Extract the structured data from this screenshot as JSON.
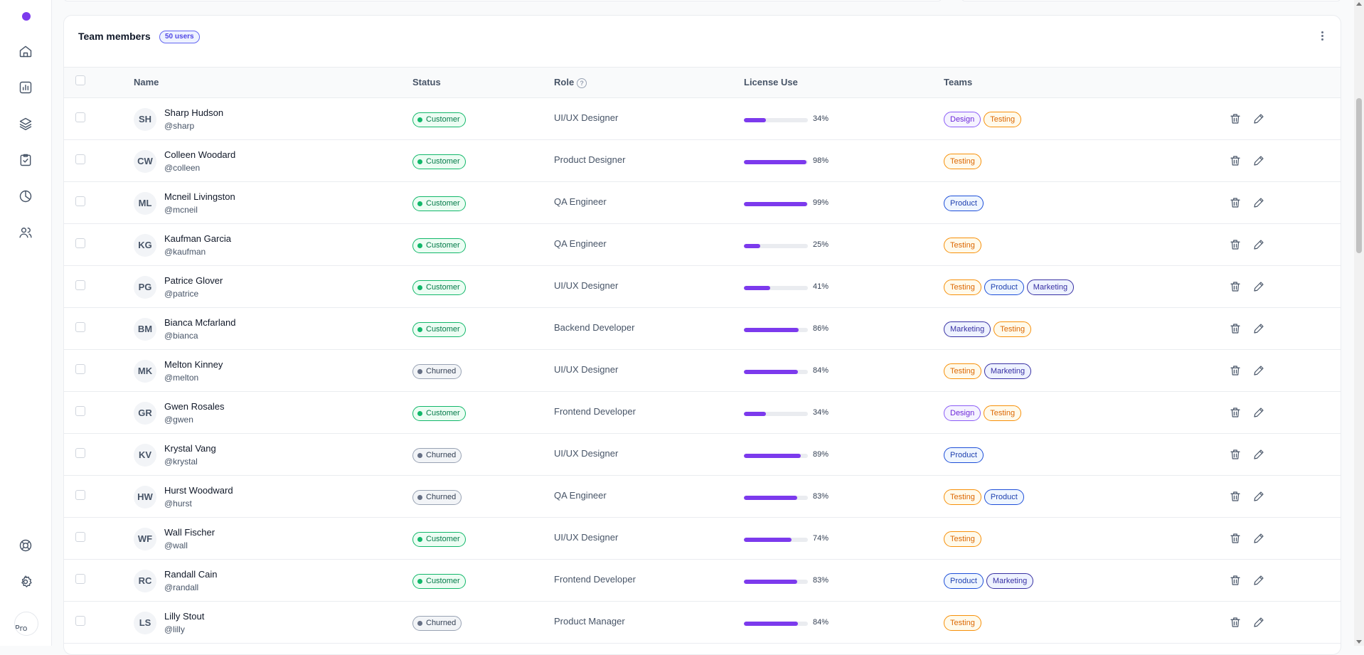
{
  "card": {
    "title": "Team members",
    "badge": "50 users"
  },
  "columns": {
    "name": "Name",
    "status": "Status",
    "role": "Role",
    "license": "License Use",
    "teams": "Teams"
  },
  "help_glyph": "?",
  "sidebar": {
    "avatar_alt": "Pro"
  },
  "rows": [
    {
      "initials": "SH",
      "name": "Sharp Hudson",
      "handle": "@sharp",
      "status": "Customer",
      "role": "UI/UX Designer",
      "license": 34,
      "license_text": "34%",
      "teams": [
        "Design",
        "Testing"
      ]
    },
    {
      "initials": "CW",
      "name": "Colleen Woodard",
      "handle": "@colleen",
      "status": "Customer",
      "role": "Product Designer",
      "license": 98,
      "license_text": "98%",
      "teams": [
        "Testing"
      ]
    },
    {
      "initials": "ML",
      "name": "Mcneil Livingston",
      "handle": "@mcneil",
      "status": "Customer",
      "role": "QA Engineer",
      "license": 99,
      "license_text": "99%",
      "teams": [
        "Product"
      ]
    },
    {
      "initials": "KG",
      "name": "Kaufman Garcia",
      "handle": "@kaufman",
      "status": "Customer",
      "role": "QA Engineer",
      "license": 25,
      "license_text": "25%",
      "teams": [
        "Testing"
      ]
    },
    {
      "initials": "PG",
      "name": "Patrice Glover",
      "handle": "@patrice",
      "status": "Customer",
      "role": "UI/UX Designer",
      "license": 41,
      "license_text": "41%",
      "teams": [
        "Testing",
        "Product",
        "Marketing"
      ]
    },
    {
      "initials": "BM",
      "name": "Bianca Mcfarland",
      "handle": "@bianca",
      "status": "Customer",
      "role": "Backend Developer",
      "license": 86,
      "license_text": "86%",
      "teams": [
        "Marketing",
        "Testing"
      ]
    },
    {
      "initials": "MK",
      "name": "Melton Kinney",
      "handle": "@melton",
      "status": "Churned",
      "role": "UI/UX Designer",
      "license": 84,
      "license_text": "84%",
      "teams": [
        "Testing",
        "Marketing"
      ]
    },
    {
      "initials": "GR",
      "name": "Gwen Rosales",
      "handle": "@gwen",
      "status": "Customer",
      "role": "Frontend Developer",
      "license": 34,
      "license_text": "34%",
      "teams": [
        "Design",
        "Testing"
      ]
    },
    {
      "initials": "KV",
      "name": "Krystal Vang",
      "handle": "@krystal",
      "status": "Churned",
      "role": "UI/UX Designer",
      "license": 89,
      "license_text": "89%",
      "teams": [
        "Product"
      ]
    },
    {
      "initials": "HW",
      "name": "Hurst Woodward",
      "handle": "@hurst",
      "status": "Churned",
      "role": "QA Engineer",
      "license": 83,
      "license_text": "83%",
      "teams": [
        "Testing",
        "Product"
      ]
    },
    {
      "initials": "WF",
      "name": "Wall Fischer",
      "handle": "@wall",
      "status": "Customer",
      "role": "UI/UX Designer",
      "license": 74,
      "license_text": "74%",
      "teams": [
        "Testing"
      ]
    },
    {
      "initials": "RC",
      "name": "Randall Cain",
      "handle": "@randall",
      "status": "Customer",
      "role": "Frontend Developer",
      "license": 83,
      "license_text": "83%",
      "teams": [
        "Product",
        "Marketing"
      ]
    },
    {
      "initials": "LS",
      "name": "Lilly Stout",
      "handle": "@lilly",
      "status": "Churned",
      "role": "Product Manager",
      "license": 84,
      "license_text": "84%",
      "teams": [
        "Testing"
      ]
    }
  ],
  "colors": {
    "accent": "#7c3aed",
    "customer": "#12b76a",
    "churned": "#98a2b3",
    "tag_design": "#8b5cf6",
    "tag_testing": "#f79009",
    "tag_product": "#1d4ed8",
    "tag_marketing": "#3730a3"
  },
  "icons": [
    "home-icon",
    "chart-icon",
    "layers-icon",
    "task-icon",
    "pie-icon",
    "users-icon",
    "support-icon",
    "settings-icon",
    "trash-icon",
    "edit-icon",
    "more-vertical-icon"
  ]
}
